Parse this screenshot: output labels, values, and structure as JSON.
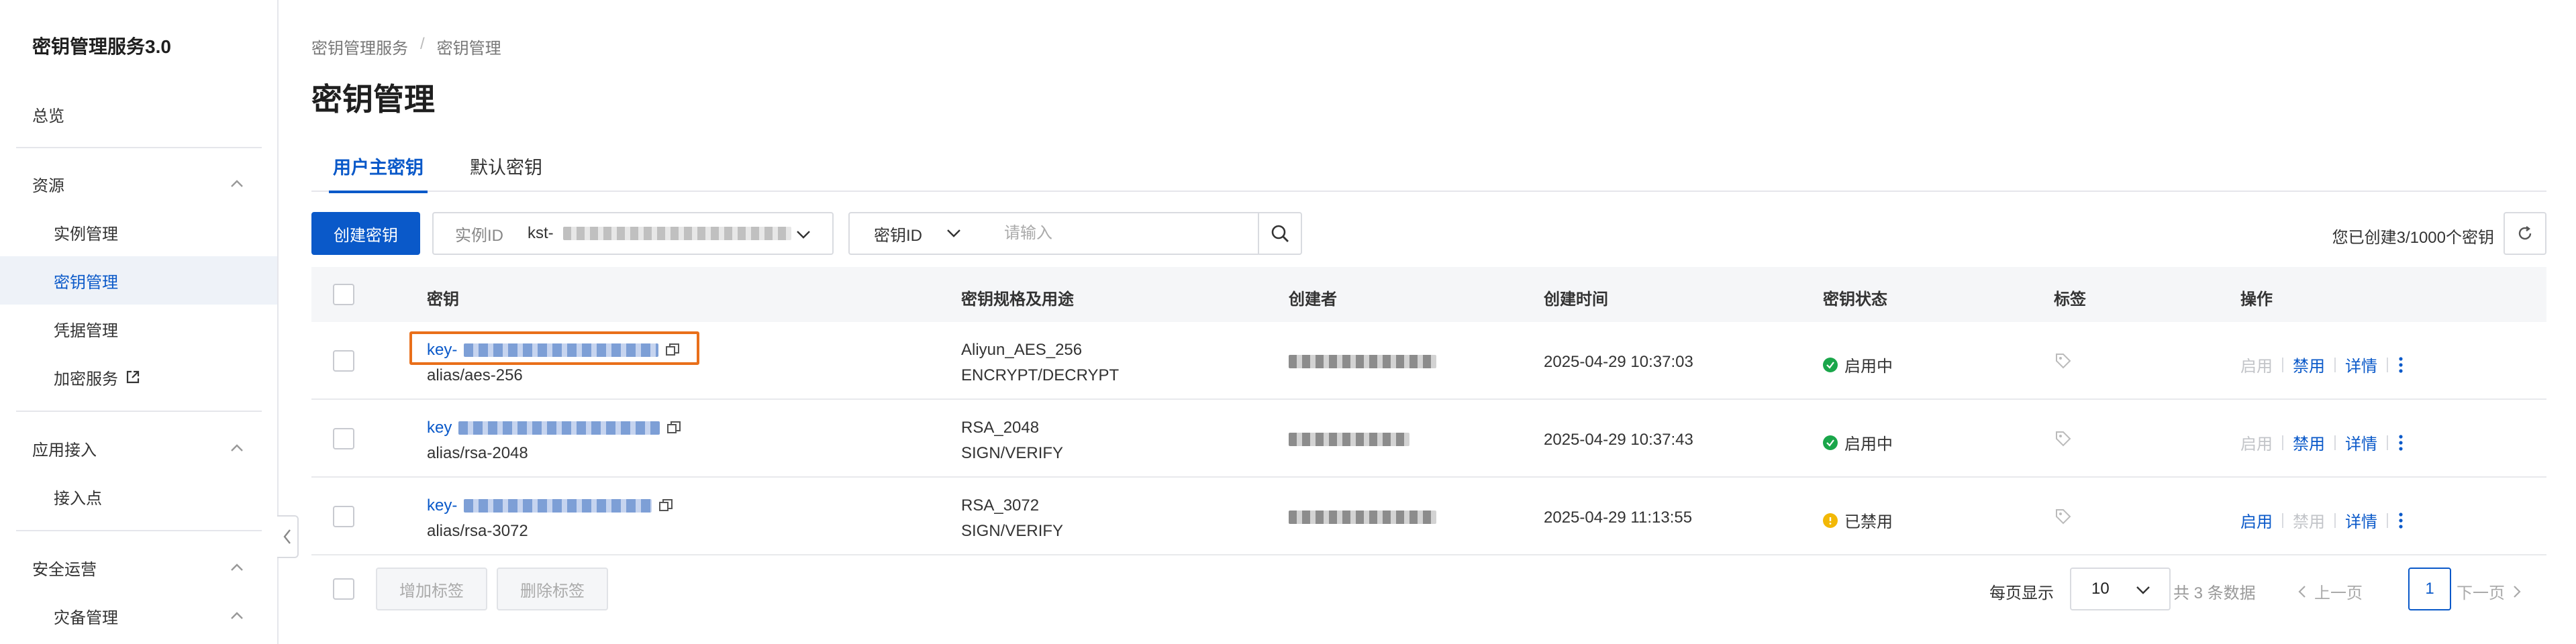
{
  "sidebar": {
    "title": "密钥管理服务3.0",
    "overview": "总览",
    "groups": [
      {
        "label": "资源",
        "items": [
          "实例管理",
          "密钥管理",
          "凭据管理",
          "加密服务"
        ]
      },
      {
        "label": "应用接入",
        "items": [
          "接入点"
        ]
      },
      {
        "label": "安全运营",
        "items": [
          "灾备管理"
        ]
      }
    ],
    "active_item": "密钥管理"
  },
  "breadcrumb": [
    "密钥管理服务",
    "密钥管理"
  ],
  "page_title": "密钥管理",
  "tabs": [
    {
      "label": "用户主密钥",
      "active": true
    },
    {
      "label": "默认密钥",
      "active": false
    }
  ],
  "toolbar": {
    "create_label": "创建密钥",
    "instance_key": "实例ID",
    "instance_value": "kst-",
    "search_field": "密钥ID",
    "search_placeholder": "请输入",
    "quota_text": "您已创建3/1000个密钥"
  },
  "table": {
    "headers": [
      "密钥",
      "密钥规格及用途",
      "创建者",
      "创建时间",
      "密钥状态",
      "标签",
      "操作"
    ],
    "rows": [
      {
        "key_prefix": "key-",
        "alias": "alias/aes-256",
        "spec": "Aliyun_AES_256",
        "usage": "ENCRYPT/DECRYPT",
        "created": "2025-04-29 10:37:03",
        "status": "启用中",
        "status_kind": "enabled",
        "ops": [
          "启用",
          "禁用",
          "详情"
        ]
      },
      {
        "key_prefix": "key",
        "alias": "alias/rsa-2048",
        "spec": "RSA_2048",
        "usage": "SIGN/VERIFY",
        "created": "2025-04-29 10:37:43",
        "status": "启用中",
        "status_kind": "enabled",
        "ops": [
          "启用",
          "禁用",
          "详情"
        ]
      },
      {
        "key_prefix": "key-",
        "alias": "alias/rsa-3072",
        "spec": "RSA_3072",
        "usage": "SIGN/VERIFY",
        "created": "2025-04-29 11:13:55",
        "status": "已禁用",
        "status_kind": "disabled",
        "ops": [
          "启用",
          "禁用",
          "详情"
        ]
      }
    ]
  },
  "footer": {
    "add_tag": "增加标签",
    "remove_tag": "删除标签",
    "per_page_label": "每页显示",
    "per_page": "10",
    "total": "共 3 条数据",
    "prev": "上一页",
    "current_page": "1",
    "next": "下一页"
  },
  "colors": {
    "primary": "#0a59c9",
    "success": "#1aa64a",
    "warning": "#f2b807",
    "highlight": "#e96f1a"
  },
  "icons": [
    "chevron-up-icon",
    "external-link-icon",
    "chevron-left-icon",
    "chevron-down-icon",
    "search-icon",
    "refresh-icon",
    "copy-icon",
    "check-circle-icon",
    "warning-circle-icon",
    "tag-icon",
    "more-vertical-icon",
    "chevron-right-icon"
  ]
}
